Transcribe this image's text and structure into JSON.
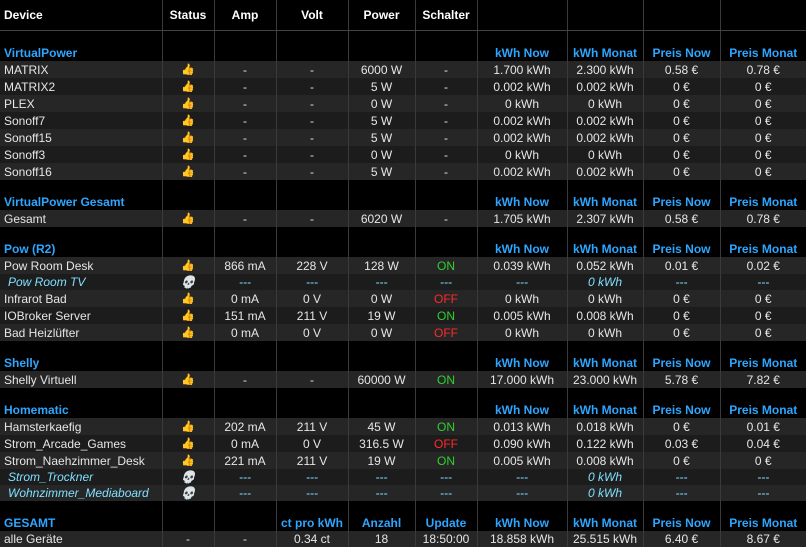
{
  "header": [
    "Device",
    "Status",
    "Amp",
    "Volt",
    "Power",
    "Schalter",
    "",
    "",
    "",
    ""
  ],
  "sections": [
    {
      "title": "VirtualPower",
      "labels": [
        "kWh Now",
        "kWh Monat",
        "Preis Now",
        "Preis Monat"
      ],
      "rows": [
        {
          "name": "MATRIX",
          "status": "thumb",
          "amp": "-",
          "volt": "-",
          "power": "6000 W",
          "schalter": "-",
          "kwh_now": "1.700 kWh",
          "kwh_monat": "2.300 kWh",
          "preis_now": "0.58 €",
          "preis_monat": "0.78 €"
        },
        {
          "name": "MATRIX2",
          "status": "thumb",
          "amp": "-",
          "volt": "-",
          "power": "5 W",
          "schalter": "-",
          "kwh_now": "0.002 kWh",
          "kwh_monat": "0.002 kWh",
          "preis_now": "0 €",
          "preis_monat": "0 €"
        },
        {
          "name": "PLEX",
          "status": "thumb",
          "amp": "-",
          "volt": "-",
          "power": "0 W",
          "schalter": "-",
          "kwh_now": "0 kWh",
          "kwh_monat": "0 kWh",
          "preis_now": "0 €",
          "preis_monat": "0 €"
        },
        {
          "name": "Sonoff7",
          "status": "thumb",
          "amp": "-",
          "volt": "-",
          "power": "5 W",
          "schalter": "-",
          "kwh_now": "0.002 kWh",
          "kwh_monat": "0.002 kWh",
          "preis_now": "0 €",
          "preis_monat": "0 €"
        },
        {
          "name": "Sonoff15",
          "status": "thumb",
          "amp": "-",
          "volt": "-",
          "power": "5 W",
          "schalter": "-",
          "kwh_now": "0.002 kWh",
          "kwh_monat": "0.002 kWh",
          "preis_now": "0 €",
          "preis_monat": "0 €"
        },
        {
          "name": "Sonoff3",
          "status": "thumb",
          "amp": "-",
          "volt": "-",
          "power": "0 W",
          "schalter": "-",
          "kwh_now": "0 kWh",
          "kwh_monat": "0 kWh",
          "preis_now": "0 €",
          "preis_monat": "0 €"
        },
        {
          "name": "Sonoff16",
          "status": "thumb",
          "amp": "-",
          "volt": "-",
          "power": "5 W",
          "schalter": "-",
          "kwh_now": "0.002 kWh",
          "kwh_monat": "0.002 kWh",
          "preis_now": "0 €",
          "preis_monat": "0 €"
        }
      ]
    },
    {
      "title": "VirtualPower Gesamt",
      "labels": [
        "kWh Now",
        "kWh Monat",
        "Preis Now",
        "Preis Monat"
      ],
      "rows": [
        {
          "name": "Gesamt",
          "status": "thumb",
          "amp": "-",
          "volt": "-",
          "power": "6020 W",
          "schalter": "-",
          "kwh_now": "1.705 kWh",
          "kwh_monat": "2.307 kWh",
          "preis_now": "0.58 €",
          "preis_monat": "0.78 €"
        }
      ]
    },
    {
      "title": "Pow (R2)",
      "labels": [
        "kWh Now",
        "kWh Monat",
        "Preis Now",
        "Preis Monat"
      ],
      "rows": [
        {
          "name": "Pow Room Desk",
          "status": "thumb",
          "amp": "866 mA",
          "volt": "228 V",
          "power": "128 W",
          "schalter": "ON",
          "kwh_now": "0.039 kWh",
          "kwh_monat": "0.052 kWh",
          "preis_now": "0.01 €",
          "preis_monat": "0.02 €"
        },
        {
          "name": "Pow Room TV",
          "status": "skull",
          "amp": "---",
          "volt": "---",
          "power": "---",
          "schalter": "---",
          "kwh_now": "---",
          "kwh_monat": "0 kWh",
          "preis_now": "---",
          "preis_monat": "---"
        },
        {
          "name": "Infrarot Bad",
          "status": "thumb",
          "amp": "0 mA",
          "volt": "0 V",
          "power": "0 W",
          "schalter": "OFF",
          "kwh_now": "0 kWh",
          "kwh_monat": "0 kWh",
          "preis_now": "0 €",
          "preis_monat": "0 €"
        },
        {
          "name": "IOBroker Server",
          "status": "thumb",
          "amp": "151 mA",
          "volt": "211 V",
          "power": "19 W",
          "schalter": "ON",
          "kwh_now": "0.005 kWh",
          "kwh_monat": "0.008 kWh",
          "preis_now": "0 €",
          "preis_monat": "0 €"
        },
        {
          "name": "Bad Heizlüfter",
          "status": "thumb",
          "amp": "0 mA",
          "volt": "0 V",
          "power": "0 W",
          "schalter": "OFF",
          "kwh_now": "0 kWh",
          "kwh_monat": "0 kWh",
          "preis_now": "0 €",
          "preis_monat": "0 €"
        }
      ]
    },
    {
      "title": "Shelly",
      "labels": [
        "kWh Now",
        "kWh Monat",
        "Preis Now",
        "Preis Monat"
      ],
      "rows": [
        {
          "name": "Shelly Virtuell",
          "status": "thumb",
          "amp": "-",
          "volt": "-",
          "power": "60000 W",
          "schalter": "ON",
          "kwh_now": "17.000 kWh",
          "kwh_monat": "23.000 kWh",
          "preis_now": "5.78 €",
          "preis_monat": "7.82 €"
        }
      ]
    },
    {
      "title": "Homematic",
      "labels": [
        "kWh Now",
        "kWh Monat",
        "Preis Now",
        "Preis Monat"
      ],
      "rows": [
        {
          "name": "Hamsterkaefig",
          "status": "thumb",
          "amp": "202 mA",
          "volt": "211 V",
          "power": "45 W",
          "schalter": "ON",
          "kwh_now": "0.013 kWh",
          "kwh_monat": "0.018 kWh",
          "preis_now": "0 €",
          "preis_monat": "0.01 €"
        },
        {
          "name": "Strom_Arcade_Games",
          "status": "thumb",
          "amp": "0 mA",
          "volt": "0 V",
          "power": "316.5 W",
          "schalter": "OFF",
          "kwh_now": "0.090 kWh",
          "kwh_monat": "0.122 kWh",
          "preis_now": "0.03 €",
          "preis_monat": "0.04 €"
        },
        {
          "name": "Strom_Naehzimmer_Desk",
          "status": "thumb",
          "amp": "221 mA",
          "volt": "211 V",
          "power": "19 W",
          "schalter": "ON",
          "kwh_now": "0.005 kWh",
          "kwh_monat": "0.008 kWh",
          "preis_now": "0 €",
          "preis_monat": "0 €"
        },
        {
          "name": "Strom_Trockner",
          "status": "skull",
          "amp": "---",
          "volt": "---",
          "power": "---",
          "schalter": "---",
          "kwh_now": "---",
          "kwh_monat": "0 kWh",
          "preis_now": "---",
          "preis_monat": "---"
        },
        {
          "name": "Wohnzimmer_Mediaboard",
          "status": "skull",
          "amp": "---",
          "volt": "---",
          "power": "---",
          "schalter": "---",
          "kwh_now": "---",
          "kwh_monat": "0 kWh",
          "preis_now": "---",
          "preis_monat": "---"
        }
      ]
    }
  ],
  "summary": {
    "title": "GESAMT",
    "labels": [
      "",
      "",
      "ct pro kWh",
      "Anzahl",
      "Update",
      "kWh Now",
      "kWh Monat",
      "Preis Now",
      "Preis Monat"
    ],
    "row": {
      "name": "alle Geräte",
      "status": "-",
      "amp": "-",
      "volt": "0.34 ct",
      "power": "18",
      "schalter": "18:50:00",
      "kwh_now": "18.858 kWh",
      "kwh_monat": "25.515 kWh",
      "preis_now": "6.40 €",
      "preis_monat": "8.67 €"
    }
  },
  "icons": {
    "thumb": "👍",
    "skull": "💀"
  },
  "colors": {
    "section": "#2ea6ff",
    "on": "#30d030",
    "off": "#ff2a2a",
    "offline": "#7fe0ff"
  }
}
